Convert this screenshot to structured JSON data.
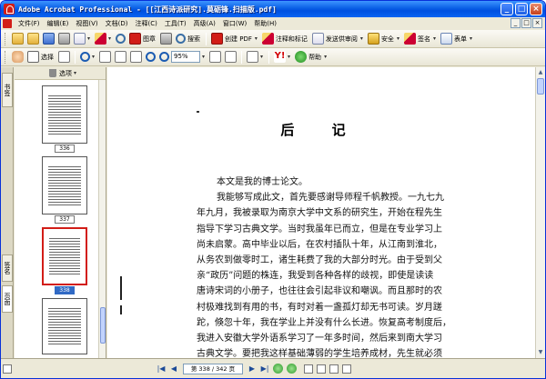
{
  "window": {
    "title": "Adobe Acrobat Professional - [[江西诗派研究].莫砺锋.扫描版.pdf]",
    "controls": [
      "_",
      "□",
      "×"
    ]
  },
  "menu": {
    "items": [
      "文件(F)",
      "编辑(E)",
      "视图(V)",
      "文档(D)",
      "注释(C)",
      "工具(T)",
      "高级(A)",
      "窗口(W)",
      "帮助(H)"
    ]
  },
  "toolbar1": {
    "print_label": "图章",
    "search_label": "搜索",
    "create_pdf_label": "创建 PDF",
    "review_label": "注释和标记",
    "send_label": "发送供审阅",
    "secure_label": "安全",
    "sign_label": "签名",
    "forms_label": "表单",
    "dropdown_glyph": "▾"
  },
  "toolbar2": {
    "select_label": "选择",
    "zoom_value": "95%",
    "help_label": "帮助"
  },
  "sidebar": {
    "tabs": [
      "书签",
      "签名",
      "页面"
    ],
    "header_label": "选项",
    "thumbnails": [
      {
        "label": "336",
        "selected": false
      },
      {
        "label": "337",
        "selected": false
      },
      {
        "label": "338",
        "selected": true
      }
    ]
  },
  "document": {
    "heading": "后  记",
    "lines": [
      "本文是我的博士论文。",
      "我能够写成此文，首先要感谢导师程千帆教授。一九七九",
      "年九月，我被录取为南京大学中文系的研究生，开始在程先生",
      "指导下学习古典文学。当时我虽年已而立，但是在专业学习上",
      "尚未启蒙。高中毕业以后，在农村插队十年，从江南到淮北，",
      "从务农到做零时工，诸生耗费了我的大部分时光。由于受到父",
      "亲“政历”问题的株连，我受到各种各样的歧视，即使是读读",
      "唐诗宋词的小册子，也往往会引起非议和嘲讽。而且那时的农",
      "村极难找到有用的书，有时对着一盏孤灯却无书可读。岁月蹉",
      "跎，倏忽十年，我在学业上并没有什么长进。恢复高考制度后，",
      "我进入安徽大学外语系学习了一年多时间，然后来到南大学习",
      "古典文学。要把我这样基础薄弱的学生培养成材，先生就必须"
    ]
  },
  "statusbar": {
    "page_field": "第 338 / 342 页",
    "nav": [
      "|◀",
      "◀",
      "▶",
      "▶|"
    ]
  }
}
